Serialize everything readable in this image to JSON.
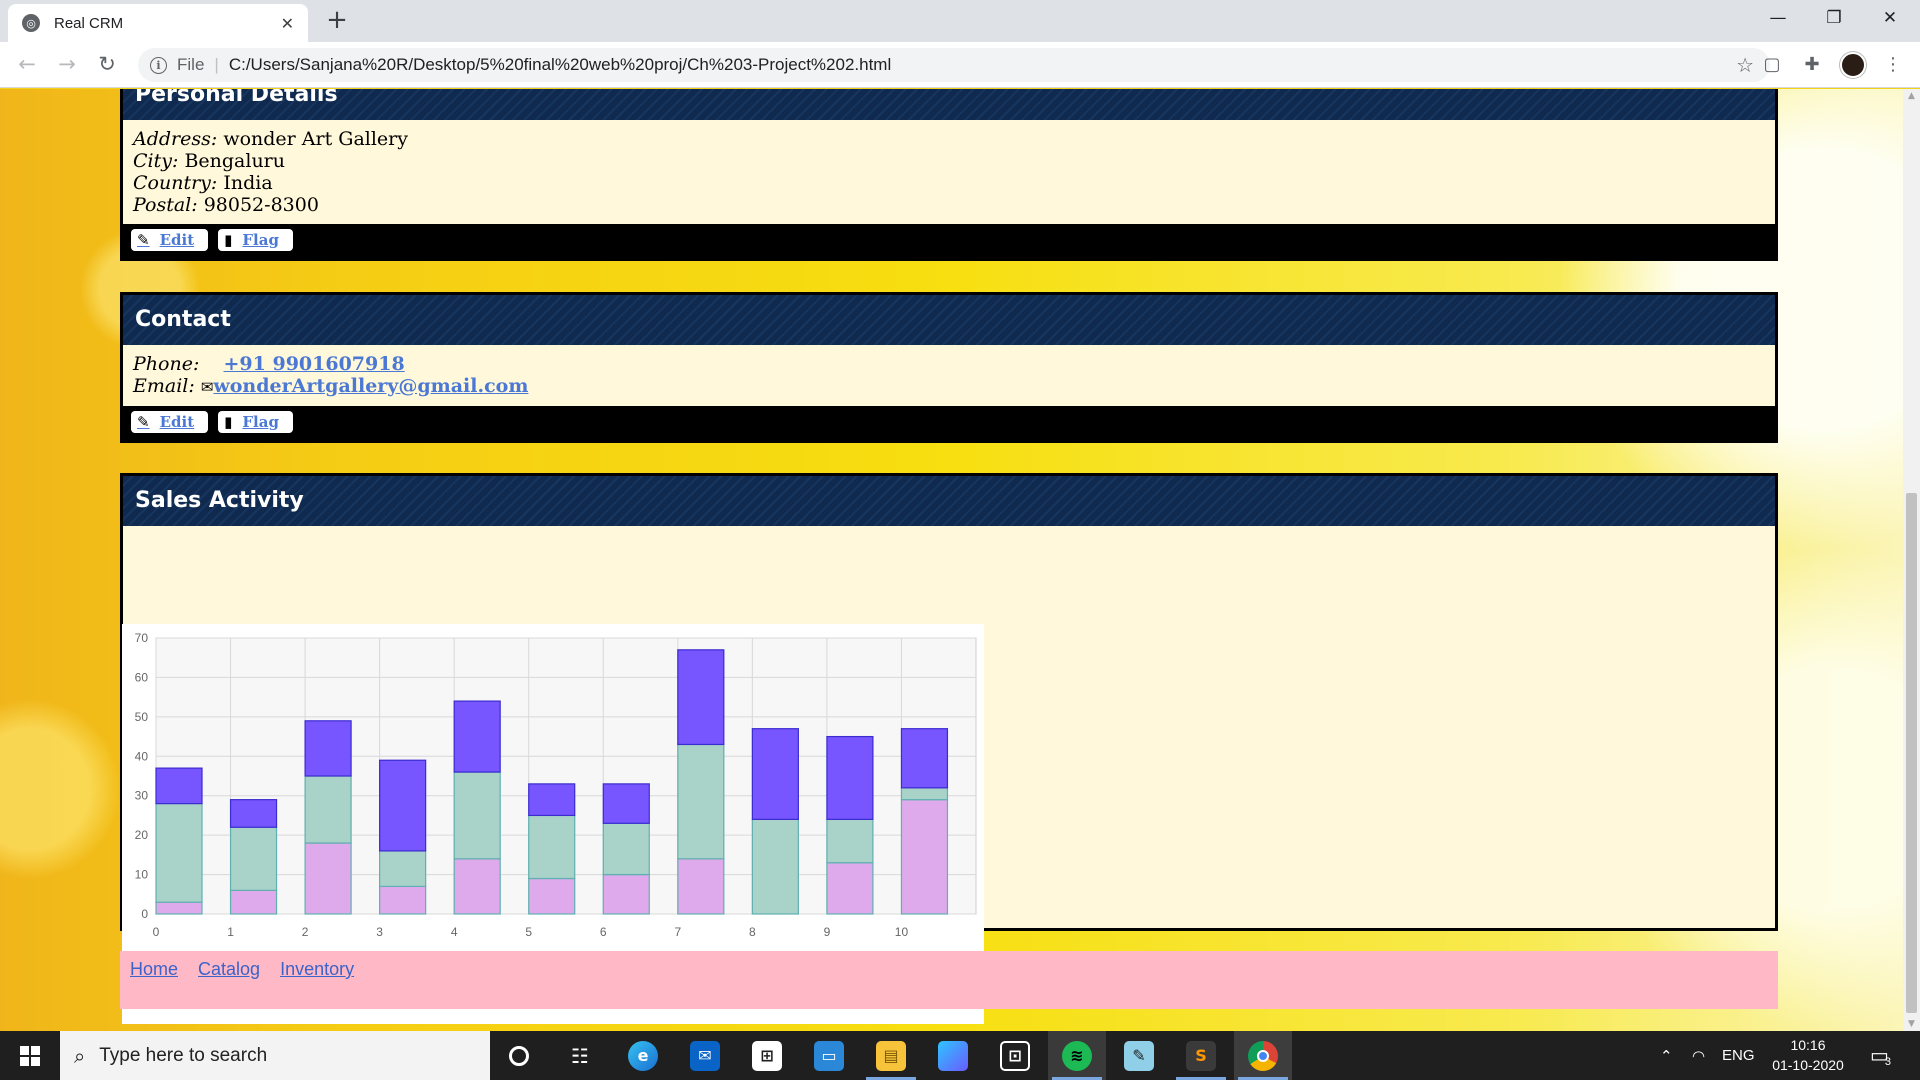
{
  "browser": {
    "tab_title": "Real CRM",
    "tab_close": "✕",
    "new_tab": "+",
    "url_scheme": "File",
    "url": "C:/Users/Sanjana%20R/Desktop/5%20final%20web%20proj/Ch%203-Project%202.html"
  },
  "personal": {
    "heading": "Personal Details",
    "address_label": "Address:",
    "address": "wonder Art Gallery",
    "city_label": "City:",
    "city": "Bengaluru",
    "country_label": "Country:",
    "country": "India",
    "postal_label": "Postal:",
    "postal": "98052-8300",
    "edit_label": "Edit",
    "flag_label": "Flag"
  },
  "contact": {
    "heading": "Contact",
    "phone_label": "Phone:",
    "phone": "+91 9901607918",
    "email_label": "Email:",
    "email": "wonderArtgallery@gmail.com",
    "edit_label": "Edit",
    "flag_label": "Flag"
  },
  "sales": {
    "heading": "Sales Activity"
  },
  "chart_data": {
    "type": "bar",
    "stacked": true,
    "x": [
      0,
      1,
      2,
      3,
      4,
      5,
      6,
      7,
      8,
      9,
      10
    ],
    "ylim": [
      0,
      70
    ],
    "yticks": [
      0,
      10,
      20,
      30,
      40,
      50,
      60,
      70
    ],
    "grid": true,
    "series": [
      {
        "values": [
          3,
          6,
          18,
          7,
          14,
          9,
          10,
          14,
          0,
          13,
          29
        ],
        "color": "#deaaec"
      },
      {
        "values": [
          25,
          16,
          17,
          9,
          22,
          16,
          13,
          29,
          24,
          11,
          3
        ],
        "color": "#a9d2c9"
      },
      {
        "values": [
          9,
          7,
          14,
          23,
          18,
          8,
          10,
          24,
          23,
          21,
          15
        ],
        "color": "#7755ff"
      }
    ]
  },
  "footer": {
    "links": [
      "Home",
      "Catalog",
      "Inventory"
    ]
  },
  "taskbar": {
    "search_placeholder": "Type here to search",
    "language": "ENG",
    "time": "10:16",
    "date": "01-10-2020",
    "notification_count": "3"
  }
}
